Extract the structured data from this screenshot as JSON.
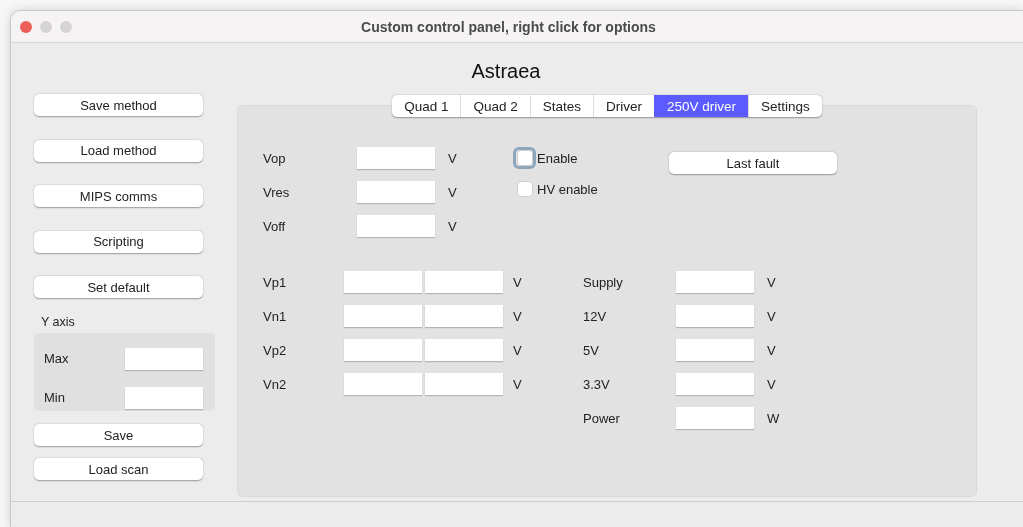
{
  "window": {
    "title": "Custom control panel, right click for options"
  },
  "heading": "Astraea",
  "sidebar": {
    "top_buttons": [
      "Save method",
      "Load method",
      "MIPS comms",
      "Scripting",
      "Set default"
    ],
    "y_axis": {
      "label": "Y axis",
      "fields": [
        {
          "label": "Max"
        },
        {
          "label": "Min"
        }
      ]
    },
    "bottom_buttons": [
      "Save",
      "Load scan"
    ]
  },
  "tabs": [
    {
      "label": "Quad 1",
      "selected": false
    },
    {
      "label": "Quad 2",
      "selected": false
    },
    {
      "label": "States",
      "selected": false
    },
    {
      "label": "Driver",
      "selected": false
    },
    {
      "label": "250V driver",
      "selected": true
    },
    {
      "label": "Settings",
      "selected": false
    }
  ],
  "panel": {
    "voltage_rows": [
      {
        "label": "Vop",
        "unit": "V"
      },
      {
        "label": "Vres",
        "unit": "V"
      },
      {
        "label": "Voff",
        "unit": "V"
      }
    ],
    "checkboxes": [
      {
        "label": "Enable",
        "checked": false,
        "focused": true
      },
      {
        "label": "HV enable",
        "checked": false,
        "focused": false
      }
    ],
    "fault_button": "Last fault",
    "pair_rows": [
      {
        "label": "Vp1",
        "unit": "V"
      },
      {
        "label": "Vn1",
        "unit": "V"
      },
      {
        "label": "Vp2",
        "unit": "V"
      },
      {
        "label": "Vn2",
        "unit": "V"
      }
    ],
    "monitor_rows": [
      {
        "label": "Supply",
        "unit": "V"
      },
      {
        "label": "12V",
        "unit": "V"
      },
      {
        "label": "5V",
        "unit": "V"
      },
      {
        "label": "3.3V",
        "unit": "V"
      },
      {
        "label": "Power",
        "unit": "W"
      }
    ]
  }
}
